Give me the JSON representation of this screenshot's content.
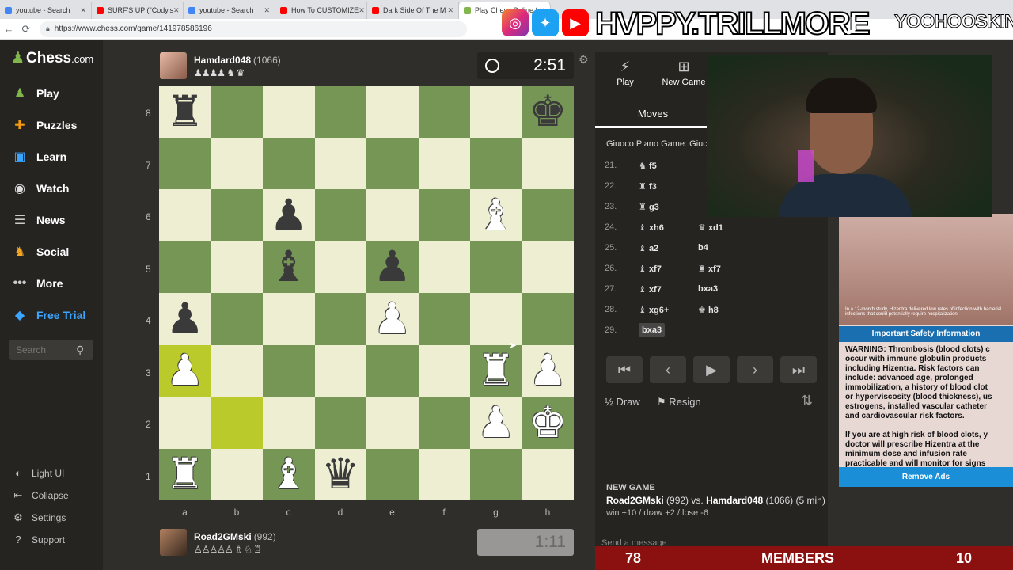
{
  "browser": {
    "tabs": [
      {
        "title": "youtube - Search",
        "color": "#4285f4"
      },
      {
        "title": "SURF'S UP (\"Cody's",
        "color": "#ff0000"
      },
      {
        "title": "youtube - Search",
        "color": "#4285f4"
      },
      {
        "title": "How To CUSTOMIZE",
        "color": "#ff0000"
      },
      {
        "title": "Dark Side Of The M",
        "color": "#ff0000"
      },
      {
        "title": "Play Chess Online f",
        "color": "#81b64c"
      }
    ],
    "url": "https://www.chess.com/game/141978586196"
  },
  "sidebar": {
    "logo": "Chess",
    "logo_suffix": ".com",
    "items": [
      {
        "label": "Play",
        "icon": "play-icon"
      },
      {
        "label": "Puzzles",
        "icon": "puzzle-icon"
      },
      {
        "label": "Learn",
        "icon": "learn-icon"
      },
      {
        "label": "Watch",
        "icon": "watch-icon"
      },
      {
        "label": "News",
        "icon": "news-icon"
      },
      {
        "label": "Social",
        "icon": "social-icon"
      },
      {
        "label": "More",
        "icon": "more-icon"
      },
      {
        "label": "Free Trial",
        "icon": "diamond-icon"
      }
    ],
    "search_placeholder": "Search",
    "bottom": [
      {
        "label": "Light UI",
        "icon": "half-circle-icon"
      },
      {
        "label": "Collapse",
        "icon": "collapse-icon"
      },
      {
        "label": "Settings",
        "icon": "gear-icon"
      },
      {
        "label": "Support",
        "icon": "help-icon"
      }
    ]
  },
  "top_player": {
    "name": "Hamdard048",
    "rating": "(1066)",
    "captures": "♟♟♟♟ ♞ ♛",
    "clock": "2:51"
  },
  "bottom_player": {
    "name": "Road2GMski",
    "rating": "(992)",
    "captures": "♙♙♙♙♙ ♗ ♘ ♖",
    "clock": "1:11"
  },
  "board": {
    "ranks": [
      "8",
      "7",
      "6",
      "5",
      "4",
      "3",
      "2",
      "1"
    ],
    "files": [
      "a",
      "b",
      "c",
      "d",
      "e",
      "f",
      "g",
      "h"
    ],
    "highlight": [
      "a3",
      "b2"
    ],
    "pieces": {
      "a8": "bR",
      "h8": "bK",
      "c6": "bP",
      "g6": "wB",
      "c5": "bB",
      "e5": "bP",
      "a4": "bP",
      "e4": "wP",
      "a3": "wP",
      "g3": "wR",
      "h3": "wP",
      "g2": "wP",
      "h2": "wK",
      "a1": "wR",
      "c1": "wB",
      "d1": "bQ"
    }
  },
  "panel": {
    "tabs": [
      {
        "label": "Play",
        "icon": "bolt-icon"
      },
      {
        "label": "New Game",
        "icon": "plus-icon"
      }
    ],
    "moves_tab": "Moves",
    "opening": "Giuoco Piano Game: Giuc",
    "moves": [
      {
        "num": "21.",
        "white": "f5",
        "wpiece": "♞",
        "black": "",
        "bpiece": ""
      },
      {
        "num": "22.",
        "white": "f3",
        "wpiece": "♜",
        "black": "",
        "bpiece": ""
      },
      {
        "num": "23.",
        "white": "g3",
        "wpiece": "♜",
        "black": "",
        "bpiece": ""
      },
      {
        "num": "24.",
        "white": "xh6",
        "wpiece": "♝",
        "black": "xd1",
        "bpiece": "♛"
      },
      {
        "num": "25.",
        "white": "a2",
        "wpiece": "♝",
        "black": "b4",
        "bpiece": ""
      },
      {
        "num": "26.",
        "white": "xf7",
        "wpiece": "♝",
        "black": "xf7",
        "bpiece": "♜"
      },
      {
        "num": "27.",
        "white": "xf7",
        "wpiece": "♝",
        "black": "bxa3",
        "bpiece": ""
      },
      {
        "num": "28.",
        "white": "xg6+",
        "wpiece": "♝",
        "black": "h8",
        "bpiece": "♚"
      },
      {
        "num": "29.",
        "white": "bxa3",
        "wpiece": "",
        "black": "",
        "bpiece": ""
      }
    ],
    "draw": "Draw",
    "resign": "Resign",
    "newgame_header": "NEW GAME",
    "newgame_white": "Road2GMski",
    "newgame_white_rating": "(992)",
    "newgame_vs": "vs.",
    "newgame_black": "Hamdard048",
    "newgame_black_rating": "(1066)",
    "newgame_time": "(5 min)",
    "newgame_stats": "win +10 / draw +2 / lose -6",
    "message_placeholder": "Send a message"
  },
  "ad": {
    "caption": "In a 12-month study, Hizentra delivered low rates of infection with bacterial infections that could potentially require hospitalization.",
    "important": "Important Safety Information",
    "warning": "WARNING: Thrombosis (blood clots) c\noccur with immune globulin products\nincluding Hizentra. Risk factors can\ninclude: advanced age, prolonged\nimmobilization, a history of blood clot\nor hyperviscosity (blood thickness), us\nestrogens, installed vascular catheter\nand cardiovascular risk factors.\n\nIf you are at high risk of blood clots, y\ndoctor will prescribe Hizentra at the\nminimum dose and infusion rate\npracticable and will monitor for signs",
    "remove": "Remove Ads"
  },
  "overlay": {
    "handle": "HVPPY.TRILLMORE",
    "handle2": "YOOHOOSKIN",
    "members_count": "78",
    "members_label": "MEMBERS",
    "members_right": "10"
  }
}
